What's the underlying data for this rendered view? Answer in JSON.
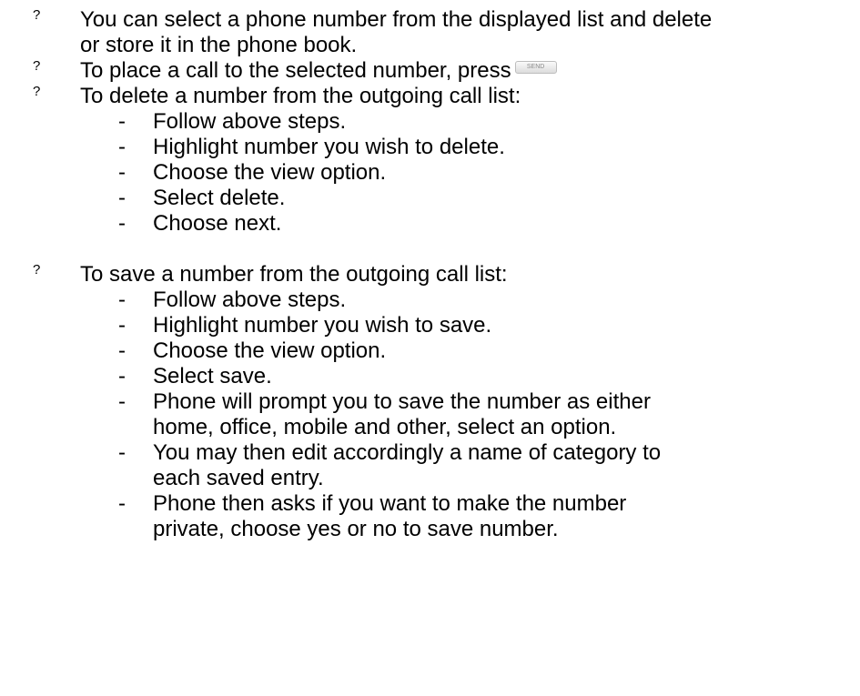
{
  "bullet_marker": "?",
  "items": [
    {
      "text": "You can select a phone number from the displayed list and delete or store it in the phone book."
    },
    {
      "text": "To place  a call to the selected number, press",
      "key_icon": "send-key-icon",
      "key_label": "SEND"
    },
    {
      "text": "To delete a number from the outgoing call list:",
      "steps": [
        "Follow above steps.",
        "Highlight number you wish to delete.",
        "Choose the view option.",
        "Select delete.",
        "Choose next."
      ]
    },
    {
      "text": "To save a number from the outgoing call list:",
      "steps": [
        "Follow above steps.",
        "Highlight number you wish to save.",
        "Choose the view option.",
        "Select save.",
        "Phone will prompt you to save the number as either home, office, mobile and other, select an option.",
        "You may then edit accordingly a name of category to each saved entry.",
        "Phone then asks if you want to make the number private, choose yes or no to save number."
      ]
    }
  ],
  "dash": "-"
}
